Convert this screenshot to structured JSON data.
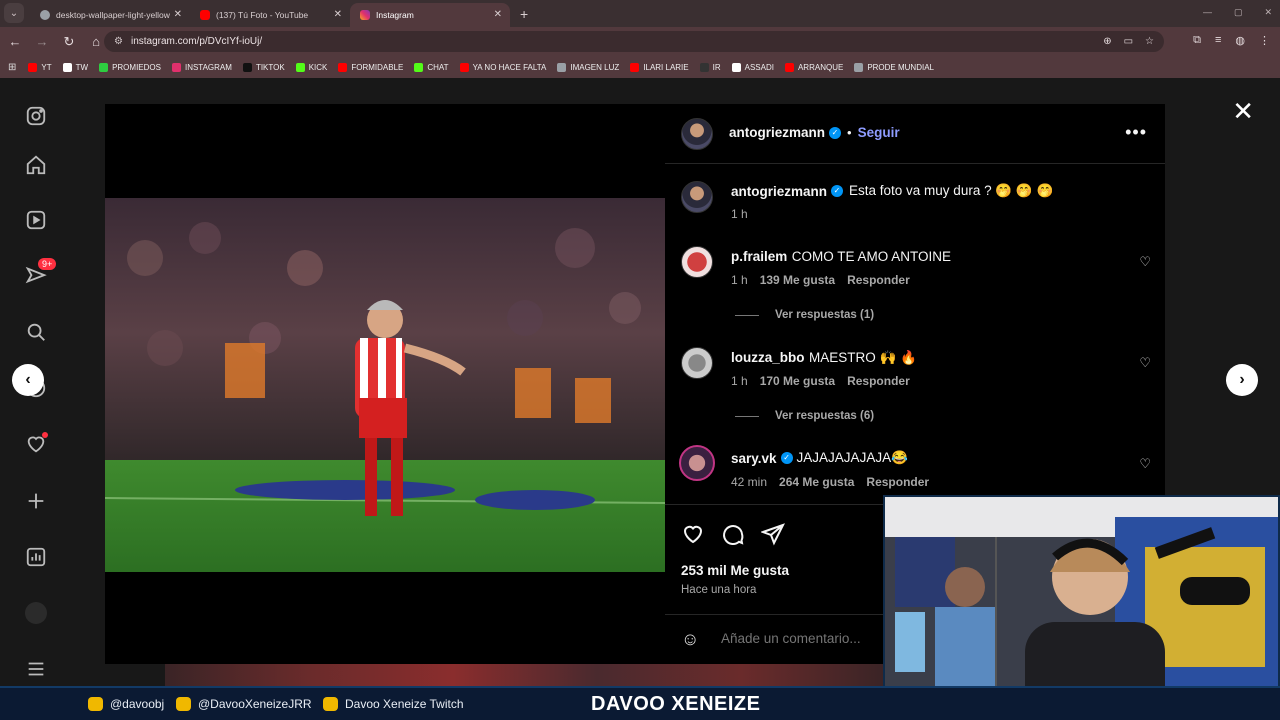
{
  "browser": {
    "tabs": [
      {
        "title": "desktop-wallpaper-light-yellow",
        "color": "#9aa0a6",
        "active": false
      },
      {
        "title": "(137) Tú Foto - YouTube",
        "color": "#ff0000",
        "active": false
      },
      {
        "title": "Instagram",
        "color": "#e1306c",
        "active": true
      }
    ],
    "url": "instagram.com/p/DVcIYf-ioUj/",
    "bookmarks": [
      {
        "label": "YT",
        "color": "#ff0000"
      },
      {
        "label": "TW",
        "color": "#ffffff"
      },
      {
        "label": "PROMIEDOS",
        "color": "#2ecc40"
      },
      {
        "label": "INSTAGRAM",
        "color": "#e1306c"
      },
      {
        "label": "TIKTOK",
        "color": "#111111"
      },
      {
        "label": "KICK",
        "color": "#53fc18"
      },
      {
        "label": "FORMIDABLE",
        "color": "#ff0000"
      },
      {
        "label": "CHAT",
        "color": "#53fc18"
      },
      {
        "label": "YA NO HACE FALTA",
        "color": "#ff0000"
      },
      {
        "label": "IMAGEN LUZ",
        "color": "#9aa0a6"
      },
      {
        "label": "ILARI LARIE",
        "color": "#ff0000"
      },
      {
        "label": "IR",
        "color": "#333333"
      },
      {
        "label": "ASSADI",
        "color": "#ffffff"
      },
      {
        "label": "ARRANQUE",
        "color": "#ff0000"
      },
      {
        "label": "PRODE MUNDIAL",
        "color": "#9aa0a6"
      }
    ]
  },
  "sidebar": {
    "notifications_badge": "9+"
  },
  "post": {
    "author": "antogriezmann",
    "follow_label": "Seguir",
    "caption_text": "Esta foto va muy dura ? 🤭 🤭 🤭",
    "caption_time": "1 h",
    "comments": [
      {
        "user": "p.frailem",
        "verified": false,
        "text": "COMO TE AMO ANTOINE",
        "time": "1 h",
        "likes": "139 Me gusta",
        "reply": "Responder",
        "view_replies": "Ver respuestas (1)"
      },
      {
        "user": "louzza_bbo",
        "verified": false,
        "text": "MAESTRO 🙌 🔥",
        "time": "1 h",
        "likes": "170 Me gusta",
        "reply": "Responder",
        "view_replies": "Ver respuestas (6)"
      },
      {
        "user": "sary.vk",
        "verified": true,
        "text": "JAJAJAJAJAJA😂",
        "time": "42 min",
        "likes": "264 Me gusta",
        "reply": "Responder"
      }
    ],
    "likes": "253 mil Me gusta",
    "posted_ago": "Hace una hora",
    "add_comment_placeholder": "Añade un comentario..."
  },
  "overlay": {
    "instagram": "@davoobj",
    "twitter": "@DavooXeneizeJRR",
    "twitch": "Davoo Xeneize Twitch",
    "title": "DAVOO XENEIZE"
  }
}
